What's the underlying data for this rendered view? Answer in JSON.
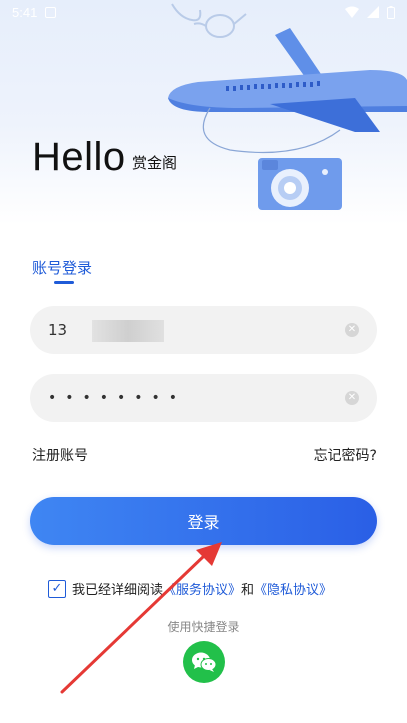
{
  "status_bar": {
    "time": "5:41"
  },
  "header": {
    "hello": "Hello",
    "app_name": "赏金阁"
  },
  "tab": {
    "label": "账号登录"
  },
  "phone_field": {
    "value": "13"
  },
  "password_field": {
    "masked_value": "••••••••"
  },
  "links": {
    "register": "注册账号",
    "forgot": "忘记密码?"
  },
  "login_button": {
    "label": "登录"
  },
  "agreement": {
    "prefix": "我已经详细阅读",
    "service": "《服务协议》",
    "and": "和",
    "privacy": "《隐私协议》",
    "checked": true
  },
  "quick_login": {
    "label": "使用快捷登录"
  },
  "colors": {
    "accent": "#1f5bd8",
    "button_start": "#3f86f3",
    "button_end": "#2a5fe6",
    "wechat": "#22c04a",
    "annotation_arrow": "#e53935"
  }
}
